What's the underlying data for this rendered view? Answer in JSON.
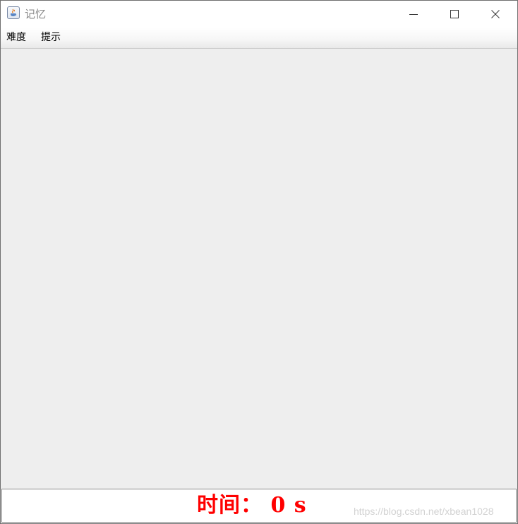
{
  "window": {
    "title": "记忆",
    "icons": {
      "app": "java-cup-icon",
      "minimize": "minimize-icon",
      "maximize": "maximize-icon",
      "close": "close-icon"
    }
  },
  "menubar": {
    "items": [
      {
        "label": "难度"
      },
      {
        "label": "提示"
      }
    ]
  },
  "status": {
    "time_text": "时间： 0 s",
    "time_color": "#ff0000"
  },
  "watermark": {
    "text": "https://blog.csdn.net/xbean1028"
  },
  "colors": {
    "content_bg": "#eeeeee",
    "title_text": "#8a8a8a"
  }
}
